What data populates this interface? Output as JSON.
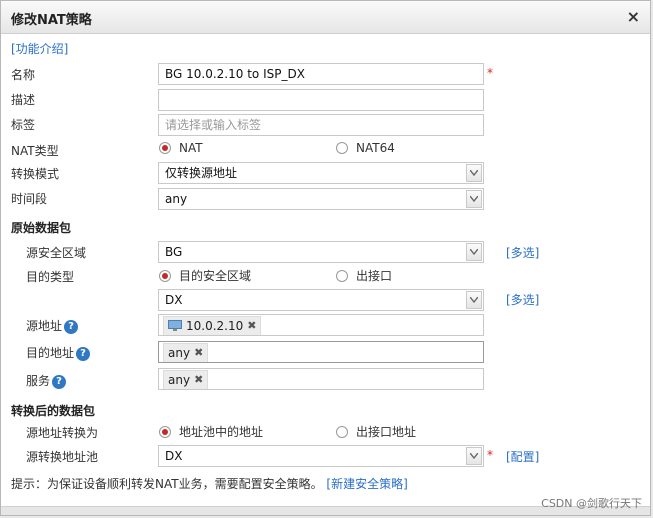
{
  "dialog": {
    "title": "修改NAT策略",
    "close_glyph": "×",
    "intro_link": "[功能介绍]"
  },
  "form": {
    "name": {
      "label": "名称",
      "value": "BG 10.0.2.10 to ISP_DX",
      "required": "*"
    },
    "description": {
      "label": "描述",
      "value": ""
    },
    "tags": {
      "label": "标签",
      "placeholder": "请选择或输入标签"
    },
    "nat_type": {
      "label": "NAT类型",
      "options": [
        "NAT",
        "NAT64"
      ],
      "selected": "NAT"
    },
    "convert_mode": {
      "label": "转换模式",
      "value": "仅转换源地址"
    },
    "time_range": {
      "label": "时间段",
      "value": "any"
    }
  },
  "original_packet": {
    "section_title": "原始数据包",
    "src_zone": {
      "label": "源安全区域",
      "value": "BG",
      "multi_link": "[多选]"
    },
    "dst_type": {
      "label": "目的类型",
      "options": [
        "目的安全区域",
        "出接口"
      ],
      "selected": "目的安全区域"
    },
    "dst_zone": {
      "value": "DX",
      "multi_link": "[多选]"
    },
    "src_addr": {
      "label": "源地址",
      "help": "?",
      "tag": "10.0.2.10",
      "tag_close": "✖"
    },
    "dst_addr": {
      "label": "目的地址",
      "help": "?",
      "tag": "any",
      "tag_close": "✖"
    },
    "service": {
      "label": "服务",
      "help": "?",
      "tag": "any",
      "tag_close": "✖"
    }
  },
  "translated_packet": {
    "section_title": "转换后的数据包",
    "src_translate": {
      "label": "源地址转换为",
      "options": [
        "地址池中的地址",
        "出接口地址"
      ],
      "selected": "地址池中的地址"
    },
    "src_pool": {
      "label": "源转换地址池",
      "value": "DX",
      "required": "*",
      "config_link": "[配置]"
    }
  },
  "hint": {
    "text": "提示：为保证设备顺利转发NAT业务，需要配置安全策略。",
    "link": "[新建安全策略]"
  },
  "watermark": "CSDN @剑歌行天下",
  "colors": {
    "accent": "#2a6fc9",
    "radio_on": "#c62828",
    "required": "#e02020"
  }
}
